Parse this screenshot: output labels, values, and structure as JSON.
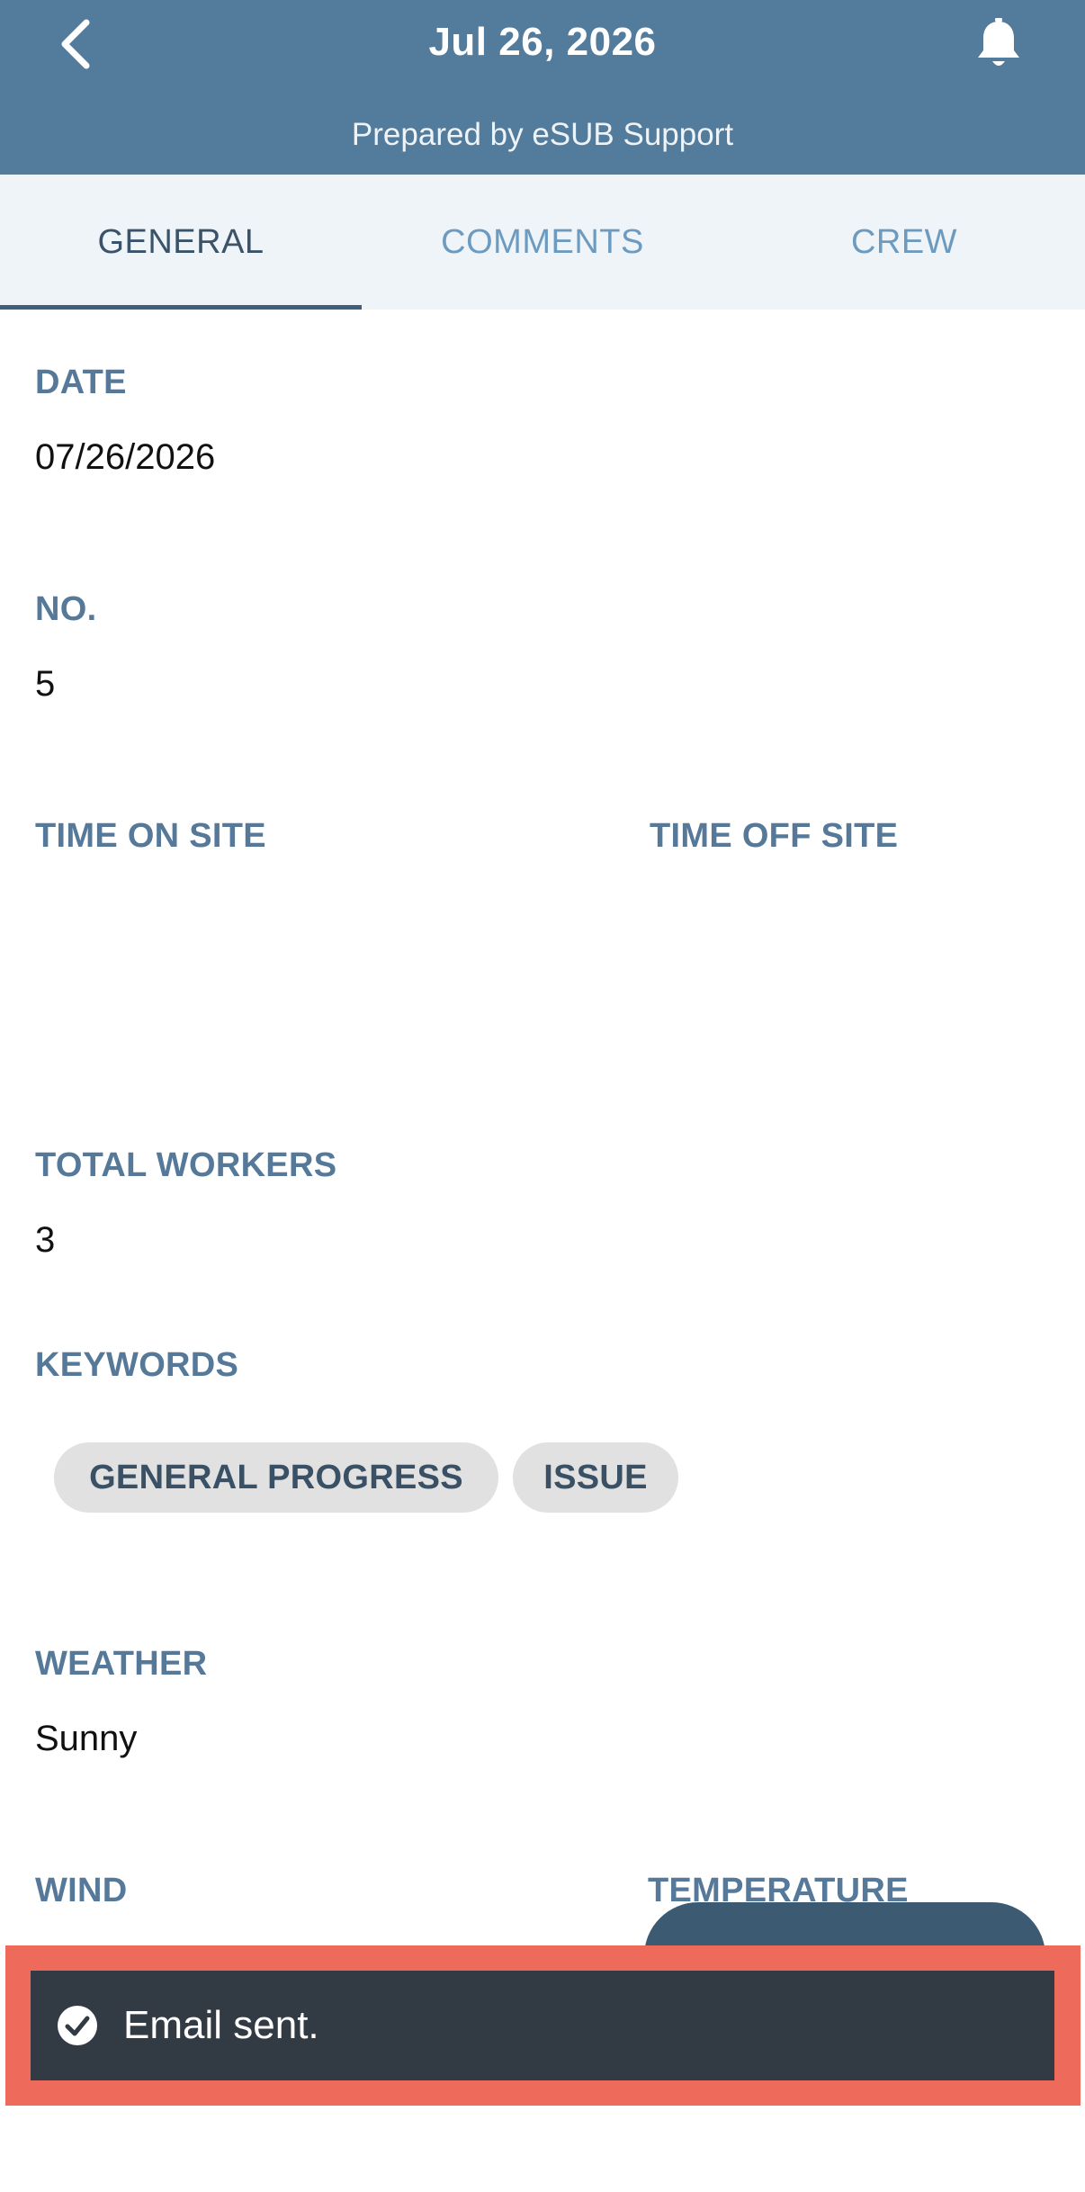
{
  "header": {
    "title": "Jul 26, 2026",
    "subtitle": "Prepared by eSUB Support",
    "back_icon": "chevron-left-icon",
    "bell_icon": "bell-icon"
  },
  "tabs": [
    {
      "label": "GENERAL",
      "active": true
    },
    {
      "label": "COMMENTS",
      "active": false
    },
    {
      "label": "CREW",
      "active": false
    }
  ],
  "fields": {
    "date": {
      "label": "DATE",
      "value": "07/26/2026"
    },
    "number": {
      "label": "NO.",
      "value": "5"
    },
    "time_on_site": {
      "label": "TIME ON SITE",
      "value": ""
    },
    "time_off_site": {
      "label": "TIME OFF SITE",
      "value": ""
    },
    "total_workers": {
      "label": "TOTAL WORKERS",
      "value": "3"
    },
    "keywords": {
      "label": "KEYWORDS",
      "items": [
        "GENERAL PROGRESS",
        "ISSUE"
      ]
    },
    "weather": {
      "label": "WEATHER",
      "value": "Sunny"
    },
    "wind": {
      "label": "WIND"
    },
    "temperature": {
      "label": "TEMPERATURE"
    }
  },
  "snackbar": {
    "message": "Email sent.",
    "icon": "check-circle-icon"
  },
  "colors": {
    "header": "#527b9c",
    "tab_bar": "#eff4f8",
    "label": "#56799a",
    "chip": "#e1e1e1",
    "snackbar": "#323a43",
    "highlight": "#ee6b5b"
  }
}
